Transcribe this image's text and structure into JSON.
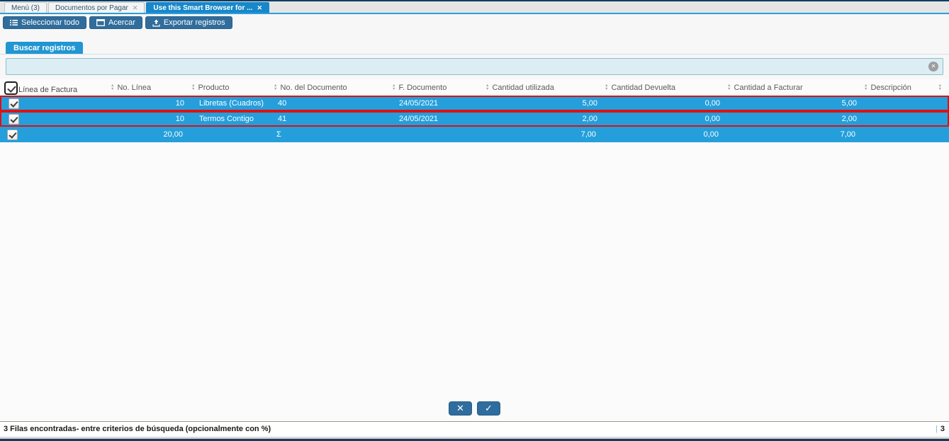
{
  "tabs": [
    {
      "label": "Menú (3)",
      "active": false,
      "closable": false
    },
    {
      "label": "Documentos por Pagar",
      "active": false,
      "closable": true
    },
    {
      "label": "Use this Smart Browser for ...",
      "active": true,
      "closable": true
    }
  ],
  "toolbar": {
    "select_all": "Seleccionar todo",
    "zoom": "Acercar",
    "export": "Exportar registros"
  },
  "search": {
    "tab_label": "Buscar registros",
    "value": "",
    "placeholder": ""
  },
  "icons": {
    "close": "✕",
    "confirm": "✓",
    "clear": "✕",
    "sort_asc": "▲",
    "sort_desc": "▼"
  },
  "table": {
    "columns": [
      {
        "label": "Línea de Factura"
      },
      {
        "label": "No. Línea"
      },
      {
        "label": "Producto"
      },
      {
        "label": "No. del Documento"
      },
      {
        "label": "F. Documento"
      },
      {
        "label": "Cantidad utilizada"
      },
      {
        "label": "Cantidad Devuelta"
      },
      {
        "label": "Cantidad a Facturar"
      },
      {
        "label": "Descripción"
      }
    ],
    "rows": [
      {
        "checked": true,
        "selected": true,
        "summary": false,
        "no_linea": "10",
        "producto": "Libretas (Cuadros)",
        "no_documento": "40",
        "f_documento": "24/05/2021",
        "cantidad_utilizada": "5,00",
        "cantidad_devuelta": "0,00",
        "cantidad_a_facturar": "5,00",
        "descripcion": ""
      },
      {
        "checked": true,
        "selected": true,
        "summary": false,
        "no_linea": "10",
        "producto": "Termos Contigo",
        "no_documento": "41",
        "f_documento": "24/05/2021",
        "cantidad_utilizada": "2,00",
        "cantidad_devuelta": "0,00",
        "cantidad_a_facturar": "2,00",
        "descripcion": ""
      },
      {
        "checked": true,
        "selected": false,
        "summary": true,
        "no_linea": "20,00",
        "producto": "",
        "no_documento": "Σ",
        "f_documento": "",
        "cantidad_utilizada": "7,00",
        "cantidad_devuelta": "0,00",
        "cantidad_a_facturar": "7,00",
        "descripcion": ""
      }
    ]
  },
  "footer": {
    "cancel": "✕",
    "confirm": "✓"
  },
  "statusbar": {
    "message": "3 Filas encontradas- entre criterios de búsqueda (opcionalmente con %)",
    "count": "3"
  },
  "colors": {
    "accent_blue": "#2196d3",
    "active_tab": "#1887c9",
    "row_blue": "#249fdb",
    "button_blue": "#306d9c",
    "selection_red": "#e01010"
  }
}
